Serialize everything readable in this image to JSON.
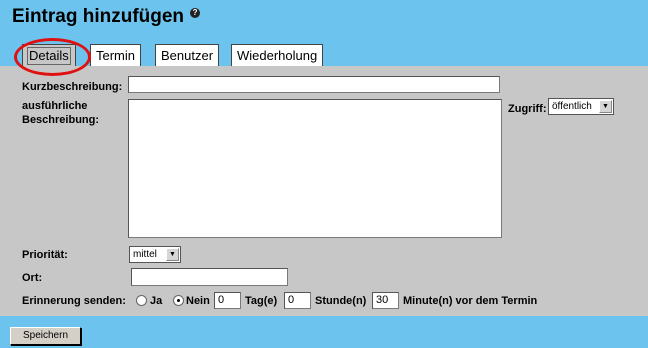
{
  "header": {
    "title": "Eintrag hinzufügen",
    "help_icon": "help-icon"
  },
  "tabs": [
    {
      "label": "Details",
      "active": true
    },
    {
      "label": "Termin",
      "active": false
    },
    {
      "label": "Benutzer",
      "active": false
    },
    {
      "label": "Wiederholung",
      "active": false
    }
  ],
  "form": {
    "short_desc_label": "Kurzbeschreibung:",
    "short_desc_value": "",
    "long_desc_label_1": "ausführliche",
    "long_desc_label_2": "Beschreibung:",
    "long_desc_value": "",
    "access_label": "Zugriff:",
    "access_value": "öffentlich",
    "priority_label": "Priorität:",
    "priority_value": "mittel",
    "location_label": "Ort:",
    "location_value": "",
    "reminder_label": "Erinnerung senden:",
    "reminder_yes": "Ja",
    "reminder_no": "Nein",
    "reminder_selected": "Nein",
    "days_value": "0",
    "days_label": "Tag(e)",
    "hours_value": "0",
    "hours_label": "Stunde(n)",
    "minutes_value": "30",
    "minutes_label": "Minute(n) vor dem Termin"
  },
  "footer": {
    "save_label": "Speichern"
  },
  "colors": {
    "background": "#6cc4ee",
    "panel": "#c7c7c7",
    "highlight": "#e01010"
  }
}
